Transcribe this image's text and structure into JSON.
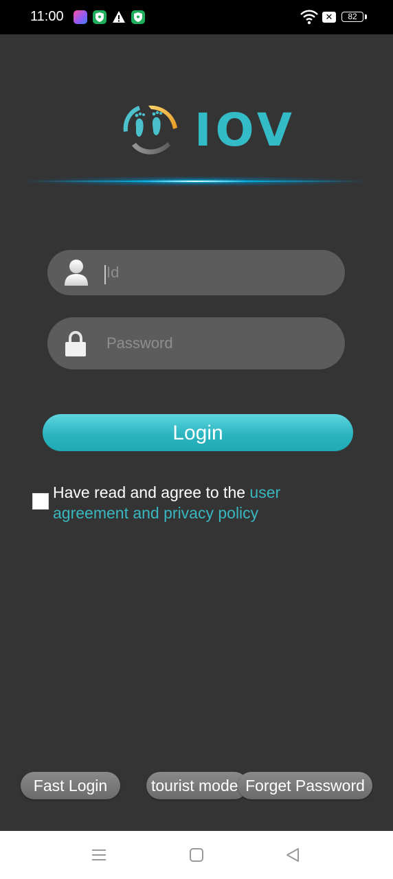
{
  "status_bar": {
    "time": "11:00",
    "battery": "82",
    "icons": [
      "gallery-app-icon",
      "shield-icon",
      "warning-icon",
      "shield-icon",
      "wifi-icon",
      "x-box-icon",
      "battery-icon"
    ]
  },
  "logo": {
    "text": "IOV",
    "icon": "footprints-logo-icon",
    "accent_color": "#33bcc7"
  },
  "form": {
    "id_placeholder": "Id",
    "password_placeholder": "Password",
    "id_icon": "user-icon",
    "password_icon": "lock-icon",
    "login_label": "Login"
  },
  "agreement": {
    "checked": false,
    "text": "Have read and agree to the ",
    "link_text": "user agreement and privacy policy",
    "link_color": "#39b7c1"
  },
  "bottom_actions": {
    "fast_login": "Fast Login",
    "tourist_mode": "tourist mode",
    "forget_password": "Forget Password"
  },
  "nav_bar": {
    "icons": [
      "menu-icon",
      "home-square-icon",
      "back-triangle-icon"
    ]
  }
}
